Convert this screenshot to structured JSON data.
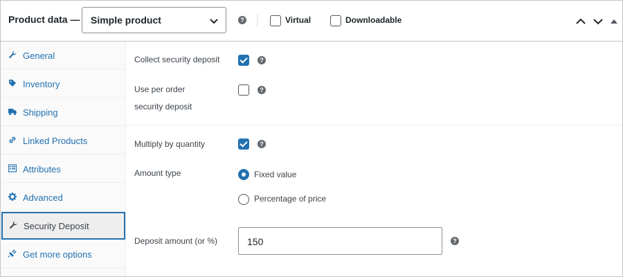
{
  "header": {
    "title": "Product data —",
    "product_type": "Simple product",
    "options": [
      {
        "label": "Virtual",
        "checked": false
      },
      {
        "label": "Downloadable",
        "checked": false
      }
    ]
  },
  "tabs": [
    {
      "label": "General",
      "icon": "wrench-icon",
      "active": false
    },
    {
      "label": "Inventory",
      "icon": "tag-icon",
      "active": false
    },
    {
      "label": "Shipping",
      "icon": "truck-icon",
      "active": false
    },
    {
      "label": "Linked Products",
      "icon": "link-icon",
      "active": false
    },
    {
      "label": "Attributes",
      "icon": "list-icon",
      "active": false
    },
    {
      "label": "Advanced",
      "icon": "gear-icon",
      "active": false
    },
    {
      "label": "Security Deposit",
      "icon": "wrench-icon",
      "active": true
    },
    {
      "label": "Get more options",
      "icon": "plugin-icon",
      "active": false
    }
  ],
  "fields": {
    "collect_deposit": {
      "label": "Collect security deposit",
      "checked": true
    },
    "per_order": {
      "label_line1": "Use per order",
      "label_line2": "security deposit",
      "checked": false
    },
    "multiply": {
      "label": "Multiply by quantity",
      "checked": true
    },
    "amount_type": {
      "label": "Amount type",
      "options": [
        {
          "label": "Fixed value",
          "selected": true
        },
        {
          "label": "Percentage of price",
          "selected": false
        }
      ]
    },
    "deposit_amount": {
      "label": "Deposit amount (or %)",
      "value": "150"
    }
  },
  "colors": {
    "accent": "#2271b1",
    "border": "#c3c4c7",
    "text": "#3c434a"
  }
}
